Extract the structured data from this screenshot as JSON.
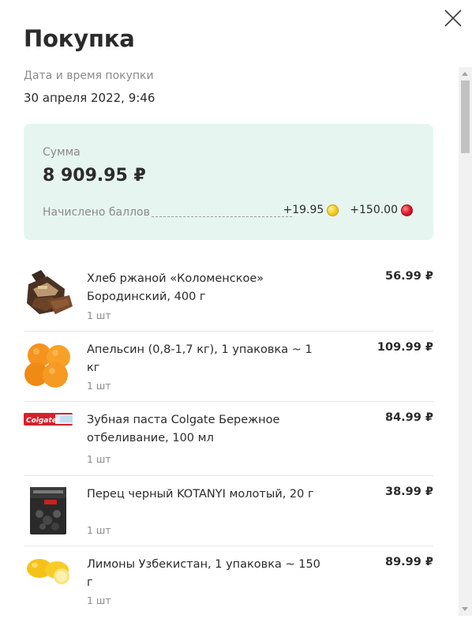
{
  "modal": {
    "title": "Покупка",
    "close_icon": "close-icon"
  },
  "purchase": {
    "date_label": "Дата и время покупки",
    "date_value": "30 апреля 2022, 9:46"
  },
  "summary": {
    "sum_label": "Сумма",
    "sum_value": "8 909.95 ₽",
    "points_label": "Начислено баллов",
    "points_yellow": "+19.95",
    "points_red": "+150.00",
    "colors": {
      "card_bg": "#e6f5ef",
      "coin_yellow": "#f6d12a",
      "coin_red": "#e2192c"
    }
  },
  "items": [
    {
      "name": "Хлеб ржаной «Коломенское» Бородинский, 400 г",
      "qty": "1 шт",
      "price": "56.99 ₽",
      "image_icon": "bread-image"
    },
    {
      "name": "Апельсин (0,8-1,7 кг), 1 упаковка ~ 1 кг",
      "qty": "1 шт",
      "price": "109.99 ₽",
      "image_icon": "orange-image"
    },
    {
      "name": "Зубная паста Colgate Бережное отбеливание, 100 мл",
      "qty": "1 шт",
      "price": "84.99 ₽",
      "image_icon": "toothpaste-image",
      "image_brand": "Colgate"
    },
    {
      "name": "Перец черный KOTANYI молотый, 20 г",
      "qty": "1 шт",
      "price": "38.99 ₽",
      "image_icon": "pepper-image"
    },
    {
      "name": "Лимоны Узбекистан, 1 упаковка ~ 150 г",
      "qty": "1 шт",
      "price": "89.99 ₽",
      "image_icon": "lemon-image"
    }
  ]
}
